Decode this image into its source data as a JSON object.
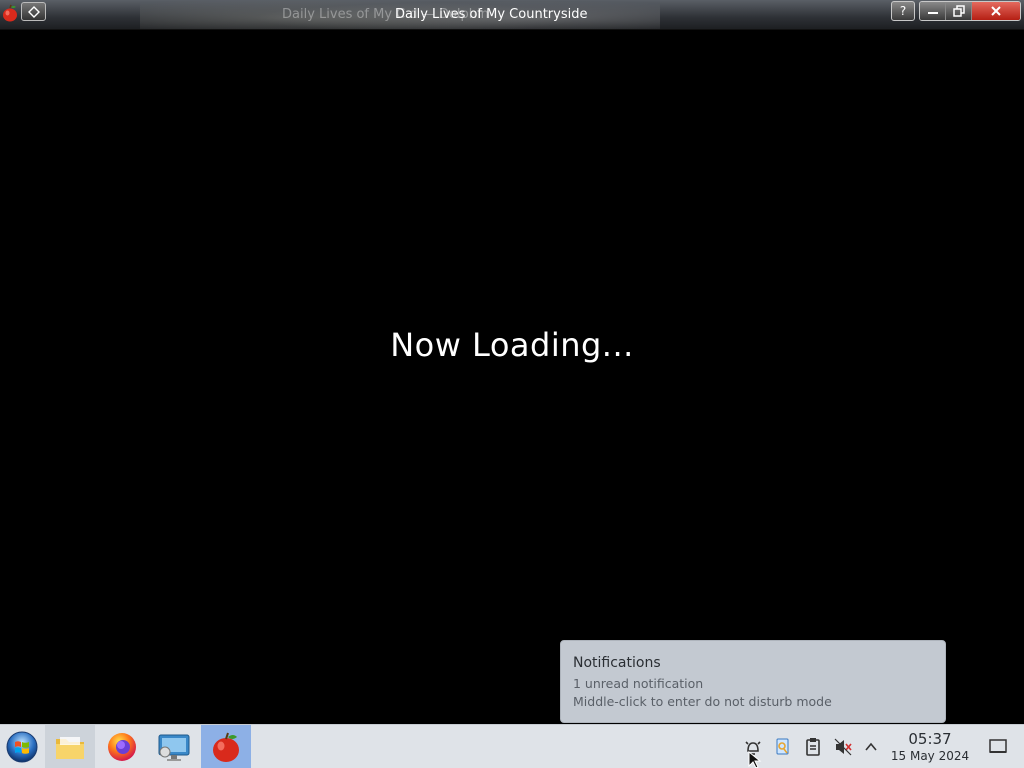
{
  "window": {
    "title": "Daily Lives of My Countryside",
    "ghost_title": "Daily Lives of My C                    d — Dolphin",
    "help_label": "?"
  },
  "game": {
    "loading_text": "Now Loading..."
  },
  "notification": {
    "title": "Notifications",
    "line1": "1 unread notification",
    "line2": "Middle-click to enter do not disturb mode"
  },
  "taskbar": {
    "items": [
      {
        "name": "start-menu",
        "icon": "windows-orb-icon"
      },
      {
        "name": "file-manager",
        "icon": "folder-icon"
      },
      {
        "name": "firefox",
        "icon": "firefox-icon"
      },
      {
        "name": "system-settings",
        "icon": "settings-monitor-icon"
      },
      {
        "name": "game",
        "icon": "apple-icon"
      }
    ],
    "tray": [
      "notifications-icon",
      "clipboard-search-icon",
      "clipboard-icon",
      "volume-muted-icon",
      "expand-tray-icon"
    ],
    "clock": {
      "time": "05:37",
      "date": "15 May 2024"
    }
  },
  "colors": {
    "accent": "#8db0e6",
    "close_button": "#d0392e",
    "notification_bg": "#c3c9d1",
    "taskbar_bg": "#dfe3e8"
  }
}
